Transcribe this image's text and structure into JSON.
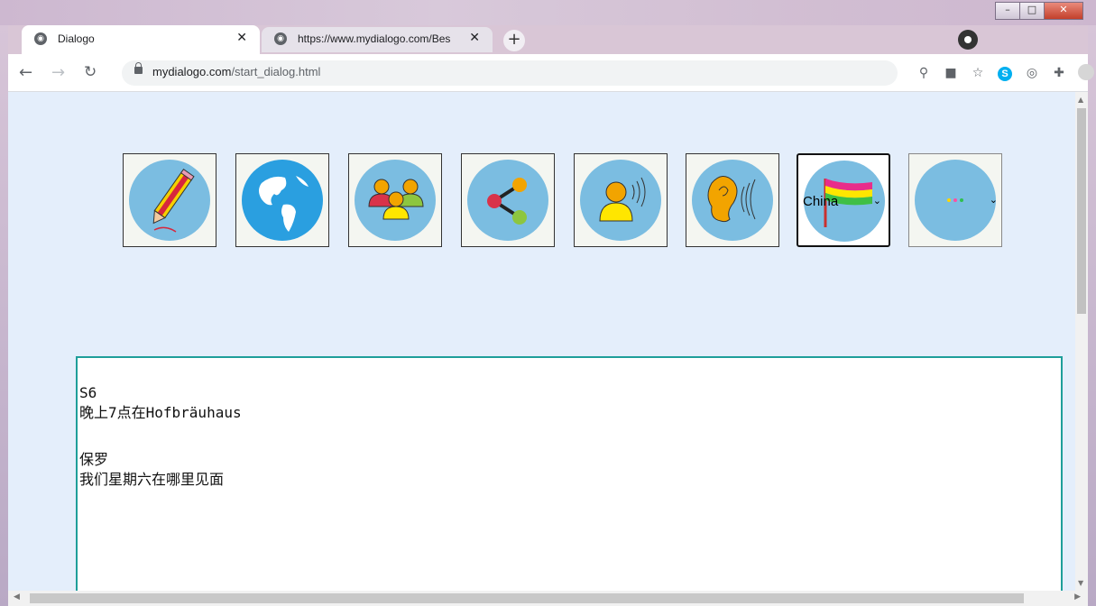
{
  "browser": {
    "tabs": [
      {
        "title": "Dialogo",
        "active": true
      },
      {
        "title": "https://www.mydialogo.com/Bes",
        "active": false
      }
    ],
    "new_tab_label": "+",
    "close_glyph": "✕",
    "address": {
      "domain": "mydialogo.com",
      "path": "/start_dialog.html"
    },
    "window_controls": {
      "minimize": "–",
      "maximize": "□",
      "close": "✕"
    },
    "extension_icons": [
      "location-icon",
      "camera-icon",
      "star-icon",
      "skype-icon",
      "vpn-icon",
      "puzzle-icon",
      "profile-icon",
      "menu-icon"
    ]
  },
  "toolbar": {
    "tools": [
      "pencil-icon",
      "globe-icon",
      "group-icon",
      "share-icon",
      "speaker-icon",
      "ear-icon"
    ],
    "language_select": {
      "value": "China",
      "icon": "flag-icon"
    },
    "color_select": {
      "value": "• • •",
      "dots": [
        "#ffd700",
        "#ff4fa3",
        "#2fbf4f"
      ]
    }
  },
  "dialog": {
    "messages": [
      {
        "speaker": "S6",
        "text": "晚上7点在Hofbräuhaus"
      },
      {
        "speaker": "保罗",
        "text": "我们星期六在哪里见面"
      }
    ]
  },
  "colors": {
    "page_bg": "#e4eefb",
    "disc": "#7bbde1",
    "dialog_border": "#1e9e9a"
  }
}
